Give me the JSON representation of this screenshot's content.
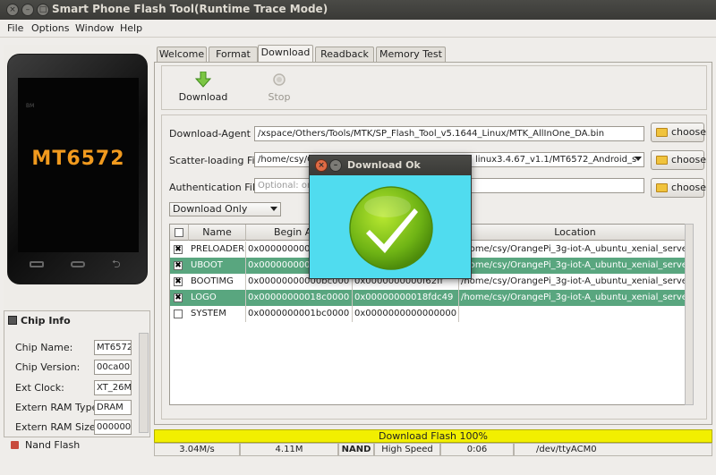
{
  "window": {
    "title": "Smart Phone Flash Tool(Runtime Trace Mode)"
  },
  "menu": [
    {
      "label": "File"
    },
    {
      "label": "Options"
    },
    {
      "label": "Window"
    },
    {
      "label": "Help"
    }
  ],
  "phone": {
    "brand": "BM",
    "model_text": "MT6572"
  },
  "chip_info": {
    "header": "Chip Info",
    "fields": [
      {
        "label": "Chip Name:",
        "value": "MT6572"
      },
      {
        "label": "Chip Version:",
        "value": "00ca00"
      },
      {
        "label": "Ext Clock:",
        "value": "XT_26M"
      },
      {
        "label": "Extern RAM Type:",
        "value": "DRAM"
      },
      {
        "label": "Extern RAM Size:",
        "value": "000000"
      }
    ],
    "footer": "Nand Flash"
  },
  "tabs": [
    {
      "label": "Welcome"
    },
    {
      "label": "Format"
    },
    {
      "label": "Download"
    },
    {
      "label": "Readback"
    },
    {
      "label": "Memory Test"
    }
  ],
  "toolbar": {
    "download_label": "Download",
    "stop_label": "Stop"
  },
  "form": {
    "download_agent": {
      "label": "Download-Agent",
      "value": "/xspace/Others/Tools/MTK/SP_Flash_Tool_v5.1644_Linux/MTK_AllInOne_DA.bin"
    },
    "scatter": {
      "label": "Scatter-loading File",
      "value": "/home/csy/Or",
      "value_tail": "linux3.4.67_v1.1/MT6572_Android_s"
    },
    "auth": {
      "label": "Authentication File",
      "placeholder": "Optional: onl"
    },
    "choose_label": "choose",
    "mode": "Download Only"
  },
  "table": {
    "headers": [
      "Name",
      "Begin Add",
      "",
      "Location"
    ],
    "rows": [
      {
        "checked": "✖",
        "name": "PRELOADER",
        "begin": "0x0000000000",
        "end": "",
        "location": "/home/csy/OrangePi_3g-iot-A_ubuntu_xenial_server...",
        "selected": false
      },
      {
        "checked": "✖",
        "name": "UBOOT",
        "begin": "0x0000000000",
        "end": "",
        "location": "/home/csy/OrangePi_3g-iot-A_ubuntu_xenial_server...",
        "selected": true
      },
      {
        "checked": "✖",
        "name": "BOOTIMG",
        "begin": "0x00000000000bc000",
        "end": "0x0000000000f62ff",
        "location": "/home/csy/OrangePi_3g-iot-A_ubuntu_xenial_server...",
        "selected": false
      },
      {
        "checked": "✖",
        "name": "LOGO",
        "begin": "0x00000000018c0000",
        "end": "0x00000000018fdc49",
        "location": "/home/csy/OrangePi_3g-iot-A_ubuntu_xenial_server...",
        "selected": true
      },
      {
        "checked": "",
        "name": "SYSTEM",
        "begin": "0x0000000001bc0000",
        "end": "0x0000000000000000",
        "location": "",
        "selected": false
      }
    ]
  },
  "progress": {
    "label": "Download Flash 100%",
    "percent": 100
  },
  "status": [
    "3.04M/s",
    "4.11M",
    "NAND",
    "High Speed",
    "0:06",
    "/dev/ttyACM0"
  ],
  "dialog": {
    "title": "Download Ok"
  },
  "colors": {
    "selected_row": "#59a67f",
    "progress": "#f2ef00",
    "dialog_bg": "#50dcef",
    "phone_text": "#f19a1e"
  }
}
